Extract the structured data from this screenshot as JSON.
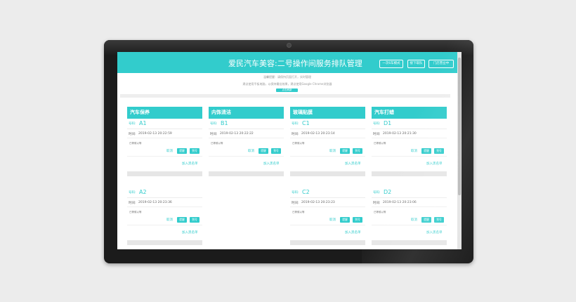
{
  "app": {
    "title": "爱民汽车美容:二号操作间服务排队管理",
    "buttons": [
      "一次6车模式",
      "接下取队",
      "门店营业中"
    ]
  },
  "notices": {
    "line1": "温馨提醒：请保持页面打开，实时管理",
    "line2": "建议使用平板电脑，以保持最佳效果，建议使用Google Chrome浏览器",
    "refresh": "点击刷新"
  },
  "labels": {
    "number": "号码:",
    "time": "时间:",
    "cancel": "取消",
    "remind": "提醒",
    "arrive": "到号",
    "join": "加入黑名单"
  },
  "columns": [
    {
      "name": "汽车保养",
      "tickets": [
        {
          "number": "A1",
          "time": "2019-02-13 20:22:59",
          "status": "已等候以等"
        },
        {
          "number": "A2",
          "time": "2019-02-13 20:23:36",
          "status": "已等候以等"
        }
      ]
    },
    {
      "name": "内饰清洁",
      "tickets": [
        {
          "number": "B1",
          "time": "2019-02-13 20:22:22",
          "status": "已等候以等"
        }
      ]
    },
    {
      "name": "玻璃贴膜",
      "tickets": [
        {
          "number": "C1",
          "time": "2019-02-13 20:23:14",
          "status": "已等候以等"
        },
        {
          "number": "C2",
          "time": "2019-02-13 20:23:23",
          "status": "已等候以等"
        }
      ]
    },
    {
      "name": "汽车打蜡",
      "tickets": [
        {
          "number": "D1",
          "time": "2019-02-13 20:21:30",
          "status": "已等候以等"
        },
        {
          "number": "D2",
          "time": "2019-02-13 20:23:06",
          "status": "已等候以等"
        }
      ]
    }
  ],
  "colors": {
    "accent": "#32cccc",
    "monitor": "#1b1b1b",
    "background": "#ececec"
  }
}
